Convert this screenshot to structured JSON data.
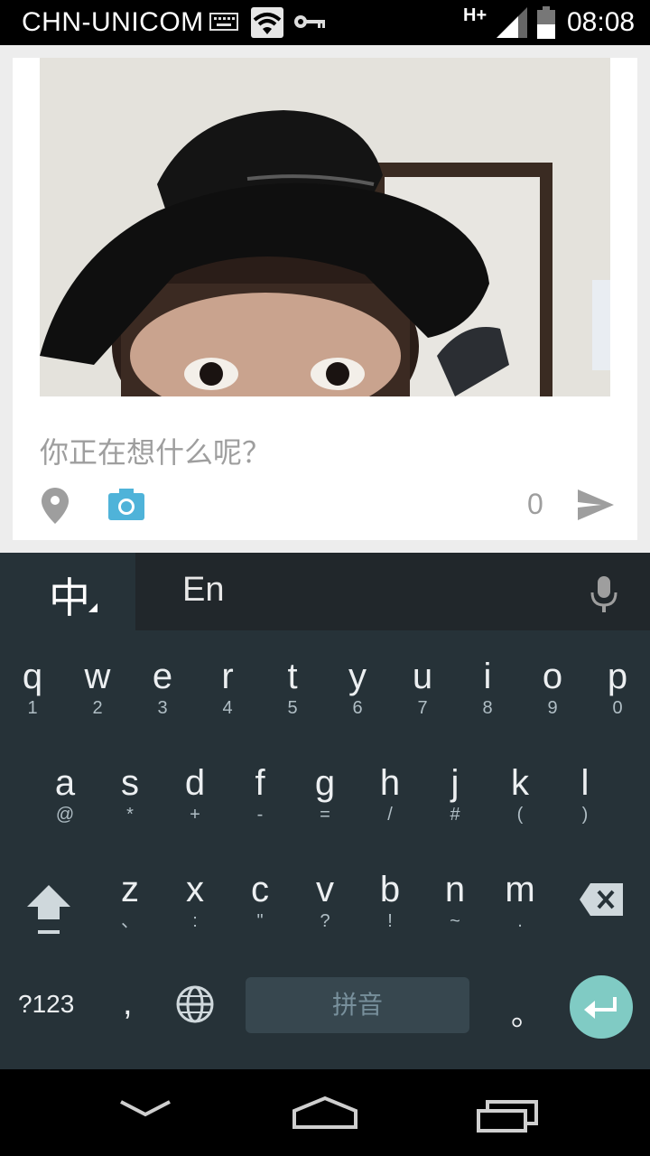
{
  "status_bar": {
    "carrier": "CHN-UNICOM",
    "network_type": "H+",
    "time": "08:08",
    "icons": [
      "keyboard-icon",
      "wifi-icon",
      "key-icon",
      "signal-icon",
      "battery-icon"
    ]
  },
  "composer": {
    "photo": "attached-photo",
    "prompt": "你正在想什么呢？",
    "char_count": "0",
    "icons": [
      "location-icon",
      "camera-icon",
      "send-icon"
    ],
    "camera_color": "#4fb3d9"
  },
  "keyboard": {
    "lang_chinese": "中",
    "lang_english": "En",
    "row1": [
      {
        "m": "q",
        "s": "1"
      },
      {
        "m": "w",
        "s": "2"
      },
      {
        "m": "e",
        "s": "3"
      },
      {
        "m": "r",
        "s": "4"
      },
      {
        "m": "t",
        "s": "5"
      },
      {
        "m": "y",
        "s": "6"
      },
      {
        "m": "u",
        "s": "7"
      },
      {
        "m": "i",
        "s": "8"
      },
      {
        "m": "o",
        "s": "9"
      },
      {
        "m": "p",
        "s": "0"
      }
    ],
    "row2": [
      {
        "m": "a",
        "s": "@"
      },
      {
        "m": "s",
        "s": "*"
      },
      {
        "m": "d",
        "s": "+"
      },
      {
        "m": "f",
        "s": "-"
      },
      {
        "m": "g",
        "s": "="
      },
      {
        "m": "h",
        "s": "/"
      },
      {
        "m": "j",
        "s": "#"
      },
      {
        "m": "k",
        "s": "("
      },
      {
        "m": "l",
        "s": ")"
      }
    ],
    "row3": [
      {
        "m": "z",
        "s": "、"
      },
      {
        "m": "x",
        "s": ":"
      },
      {
        "m": "c",
        "s": "\""
      },
      {
        "m": "v",
        "s": "?"
      },
      {
        "m": "b",
        "s": "!"
      },
      {
        "m": "n",
        "s": "~"
      },
      {
        "m": "m",
        "s": "."
      }
    ],
    "symbols_key": "?123",
    "comma_key": ",",
    "space_key": "拼音",
    "period_key": "。",
    "accent_color": "#80cbc4"
  }
}
